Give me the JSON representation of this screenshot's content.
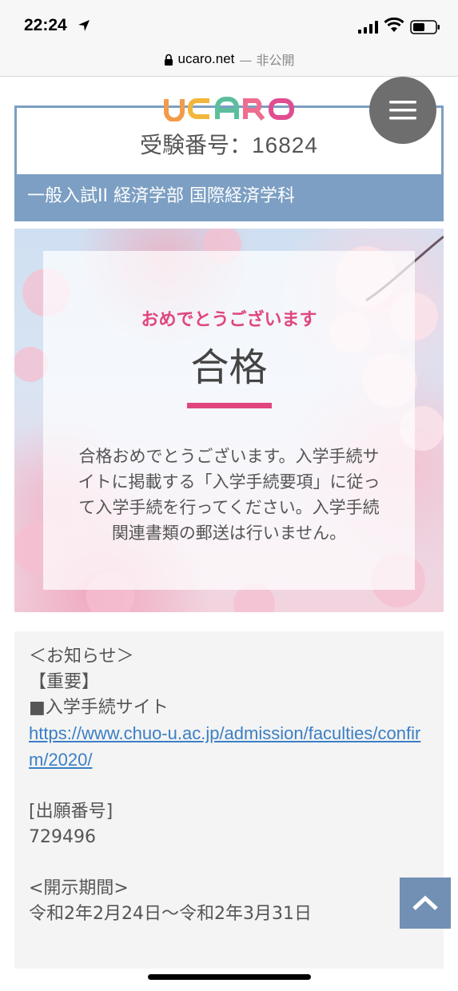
{
  "status_bar": {
    "time": "22:24"
  },
  "url_bar": {
    "domain": "ucaro.net",
    "status": "— 非公開"
  },
  "header": {
    "logo_text": "UCARO",
    "exam_label": "受験番号：",
    "exam_number": "16824",
    "department": "一般入試II 経済学部 国際経済学科"
  },
  "result": {
    "congrats": "おめでとうございます",
    "title": "合格",
    "message": "合格おめでとうございます。入学手続サイトに掲載する「入学手続要項」に従って入学手続を行ってください。入学手続関連書類の郵送は行いません。"
  },
  "notice": {
    "heading": "＜お知らせ＞",
    "important": "【重要】",
    "site_label": "■入学手続サイト",
    "site_url": "https://www.chuo-u.ac.jp/admission/faculties/confirm/2020/",
    "application_label": "[出願番号]",
    "application_number": "729496",
    "period_label": "<開示期間>",
    "period_value": "令和2年2月24日～令和2年3月31日"
  },
  "colors": {
    "accent_pink": "#e0467d",
    "header_blue": "#7c9fc3",
    "menu_gray": "#6e6e6e",
    "link_blue": "#3b7fc4"
  },
  "icons": [
    "location-arrow-icon",
    "signal-icon",
    "wifi-icon",
    "battery-icon",
    "lock-icon",
    "hamburger-menu-icon",
    "chevron-up-icon"
  ]
}
